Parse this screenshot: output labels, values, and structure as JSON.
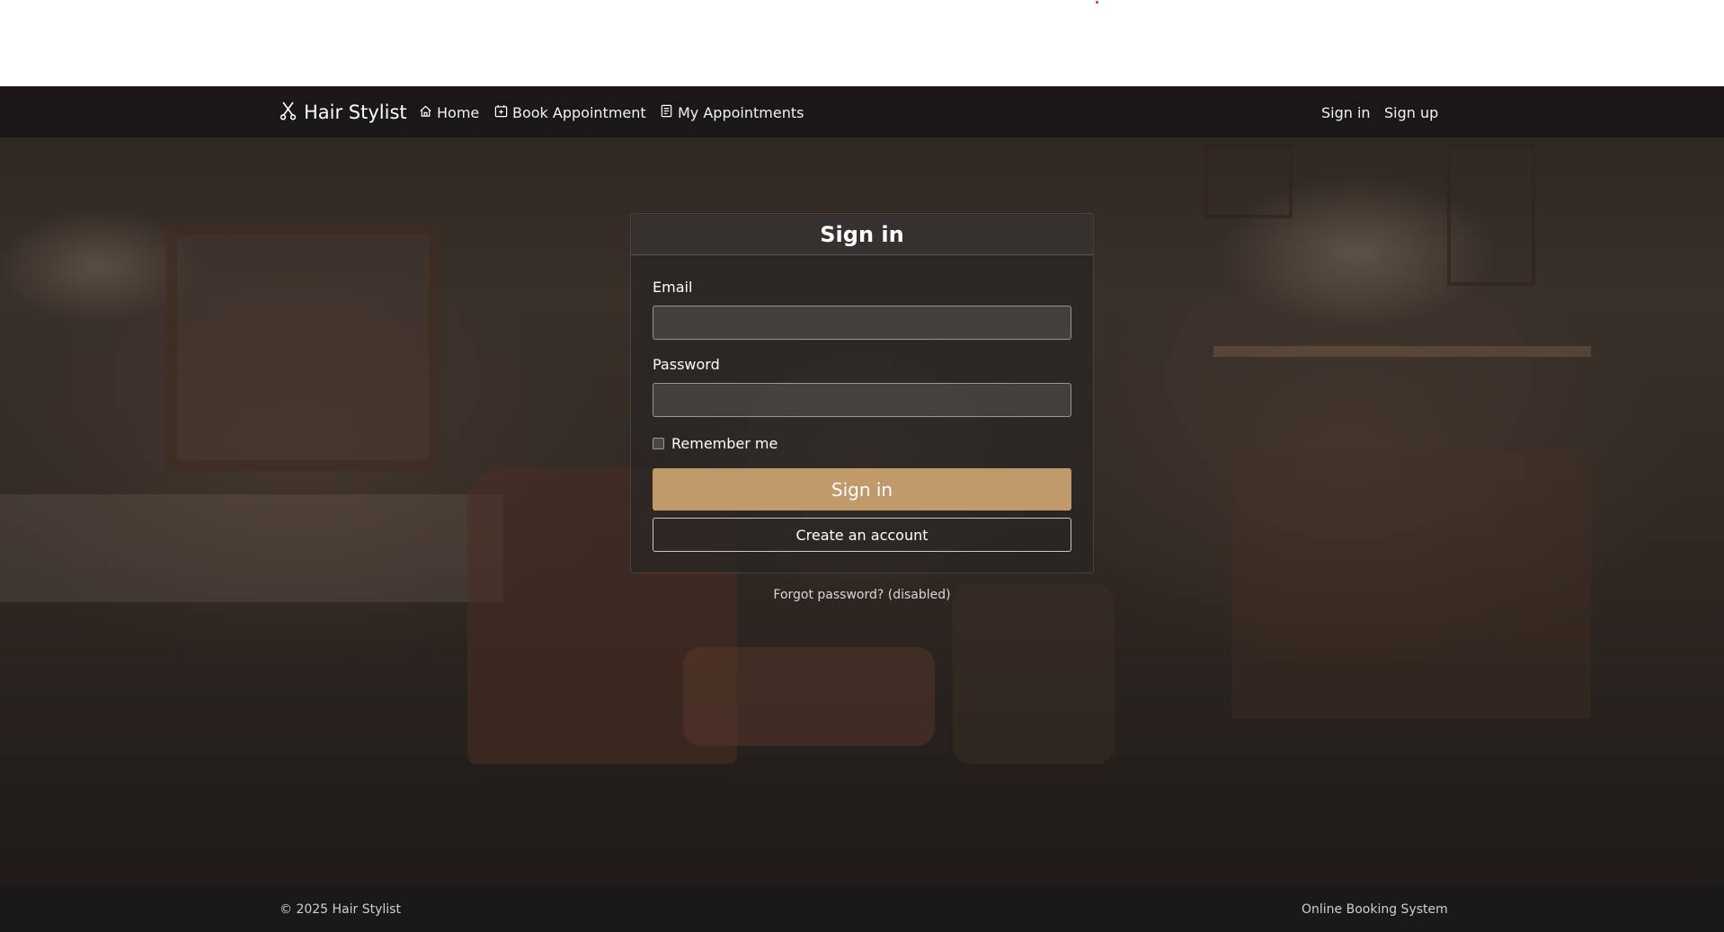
{
  "navbar": {
    "brand": "Hair Stylist",
    "brand_icon": "scissors-icon",
    "links": [
      {
        "label": "Home",
        "icon": "home-icon"
      },
      {
        "label": "Book Appointment",
        "icon": "calendar-plus-icon"
      },
      {
        "label": "My Appointments",
        "icon": "document-list-icon"
      }
    ],
    "auth": {
      "signin": "Sign in",
      "signup": "Sign up"
    }
  },
  "form": {
    "title": "Sign in",
    "email_label": "Email",
    "email_value": "",
    "password_label": "Password",
    "password_value": "",
    "remember_label": "Remember me",
    "remember_checked": false,
    "submit_label": "Sign in",
    "create_label": "Create an account",
    "forgot_text": "Forgot password? (disabled)"
  },
  "footer": {
    "left": "© 2025 Hair Stylist",
    "right": "Online Booking System"
  },
  "colors": {
    "accent": "#c09a6b",
    "navbar_bg": "#181615",
    "footer_bg": "#1b1918"
  }
}
